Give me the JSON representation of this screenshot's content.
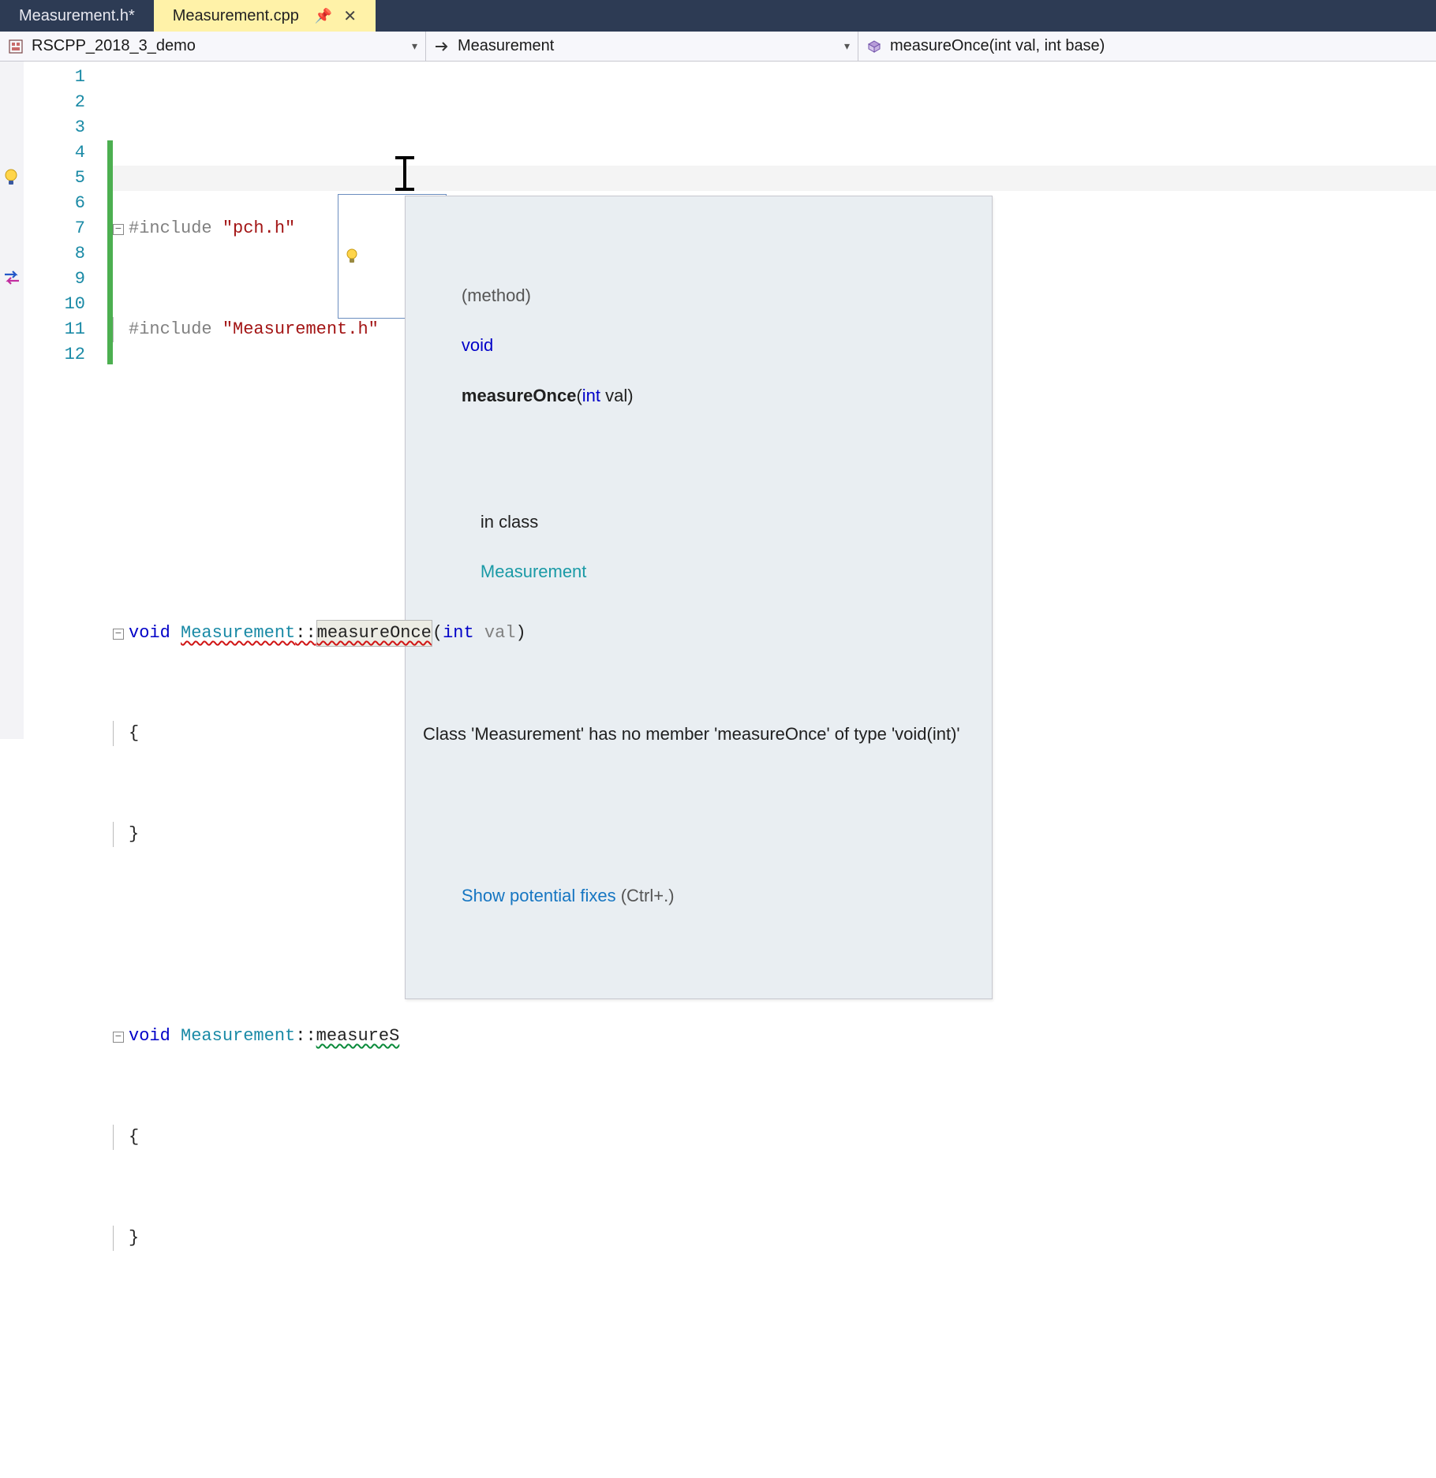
{
  "tabs": {
    "inactive_label": "Measurement.h*",
    "active_label": "Measurement.cpp"
  },
  "nav": {
    "project": "RSCPP_2018_3_demo",
    "class": "Measurement",
    "member": "measureOnce(int val, int base)"
  },
  "code": {
    "line1_include": "#include",
    "line1_str": "\"pch.h\"",
    "line2_include": "#include",
    "line2_str": "\"Measurement.h\"",
    "void": "void",
    "class": "Measurement",
    "scope": "::",
    "method_a": "measureOnce",
    "method_a_sig_open": "(",
    "method_a_kw": "int",
    "method_a_param": "val",
    "method_a_sig_close": ")",
    "brace_open": "{",
    "brace_close": "}",
    "method_b_prefix": "measureS"
  },
  "line_numbers": [
    "1",
    "2",
    "3",
    "4",
    "5",
    "6",
    "7",
    "8",
    "9",
    "10",
    "11",
    "12"
  ],
  "tooltip": {
    "tag": "(method)",
    "ret": "void",
    "name": "measureOnce",
    "sig_open": "(",
    "sig_kw": "int",
    "sig_param": " val)",
    "row2_in": "in class",
    "row2_class": "Measurement",
    "error": "Class 'Measurement' has no member 'measureOnce' of type 'void(int)'",
    "fix_link": "Show potential fixes",
    "fix_hint": " (Ctrl+.)"
  },
  "colors": {
    "tab_active_bg": "#fff2a8",
    "tab_inactive_bg": "#2d3b54",
    "keyword": "#0000c8",
    "type": "#1a8aa6",
    "string": "#a31515"
  }
}
